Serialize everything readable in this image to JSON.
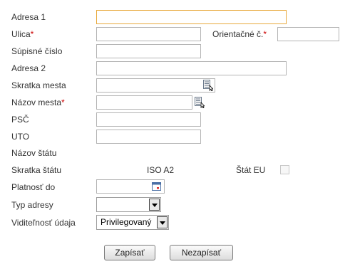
{
  "fields": {
    "adresa1": {
      "label": "Adresa 1",
      "value": ""
    },
    "ulica": {
      "label": "Ulica",
      "required_mark": "*",
      "value": ""
    },
    "orientacne": {
      "label": "Orientačné č.",
      "required_mark": "*",
      "value": ""
    },
    "supisne": {
      "label": "Súpisné číslo",
      "value": ""
    },
    "adresa2": {
      "label": "Adresa 2",
      "value": ""
    },
    "skratka_mesta": {
      "label": "Skratka mesta",
      "value": "",
      "icon": "list-picker-icon"
    },
    "nazov_mesta": {
      "label": "Názov mesta",
      "required_mark": "*",
      "value": "",
      "icon": "list-picker-icon"
    },
    "psc": {
      "label": "PSČ",
      "value": ""
    },
    "uto": {
      "label": "UTO",
      "value": ""
    },
    "nazov_statu": {
      "label": "Názov štátu"
    },
    "skratka_statu": {
      "label": "Skratka štátu",
      "iso_label": "ISO A2",
      "eu_label": "Štát EU",
      "eu_checked": false
    },
    "platnost": {
      "label": "Platnosť do",
      "value": "",
      "icon": "calendar-icon"
    },
    "typ_adresy": {
      "label": "Typ adresy",
      "selected": ""
    },
    "viditelnost": {
      "label": "Viditeľnosť údaja",
      "selected": "Privilegovaný"
    }
  },
  "buttons": {
    "save": "Zapísať",
    "cancel": "Nezapísať"
  },
  "colors": {
    "required": "#cc0000",
    "focus_border": "#e8a93c",
    "input_border": "#b4b4b4",
    "text": "#333333"
  }
}
